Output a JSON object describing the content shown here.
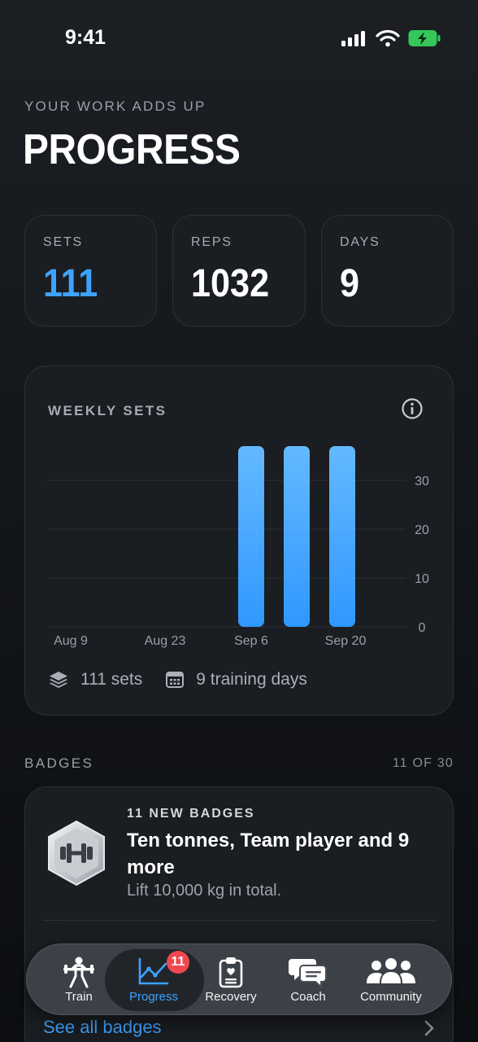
{
  "status_bar": {
    "time": "9:41"
  },
  "header": {
    "eyebrow": "YOUR WORK ADDS UP",
    "title": "PROGRESS"
  },
  "stats": [
    {
      "label": "SETS",
      "value": "111"
    },
    {
      "label": "REPS",
      "value": "1032"
    },
    {
      "label": "DAYS",
      "value": "9"
    }
  ],
  "weekly_card": {
    "title": "WEEKLY SETS",
    "footer_sets": "111 sets",
    "footer_days": "9 training days"
  },
  "chart_data": {
    "type": "bar",
    "title": "WEEKLY SETS",
    "x_tick_labels": [
      "Aug 9",
      "Aug 23",
      "Sep 6",
      "Sep 20"
    ],
    "y_ticks": [
      "0",
      "10",
      "20",
      "30"
    ],
    "ylim": [
      0,
      40
    ],
    "categories": [
      "Sep 6",
      "Sep 13",
      "Sep 20"
    ],
    "values": [
      37,
      37,
      37
    ],
    "bar_color": "#3ea2ff",
    "grid": true,
    "y_axis_side": "right"
  },
  "badges": {
    "section_title": "BADGES",
    "count": "11 OF 30",
    "eyebrow": "11 NEW BADGES",
    "title": "Ten tonnes, Team player and 9 more",
    "description": "Lift 10,000 kg in total.",
    "see_all": "See all badges"
  },
  "tab_bar": {
    "tabs": [
      {
        "label": "Train",
        "icon": "weightlifter-icon"
      },
      {
        "label": "Progress",
        "icon": "trend-chart-icon"
      },
      {
        "label": "Recovery",
        "icon": "clipboard-heart-icon"
      },
      {
        "label": "Coach",
        "icon": "chat-bubbles-icon"
      },
      {
        "label": "Community",
        "icon": "people-group-icon"
      }
    ],
    "progress_badge": "11"
  },
  "colors": {
    "accent": "#3ea2ff",
    "badge_red": "#f0484e",
    "battery_green": "#34c759"
  }
}
